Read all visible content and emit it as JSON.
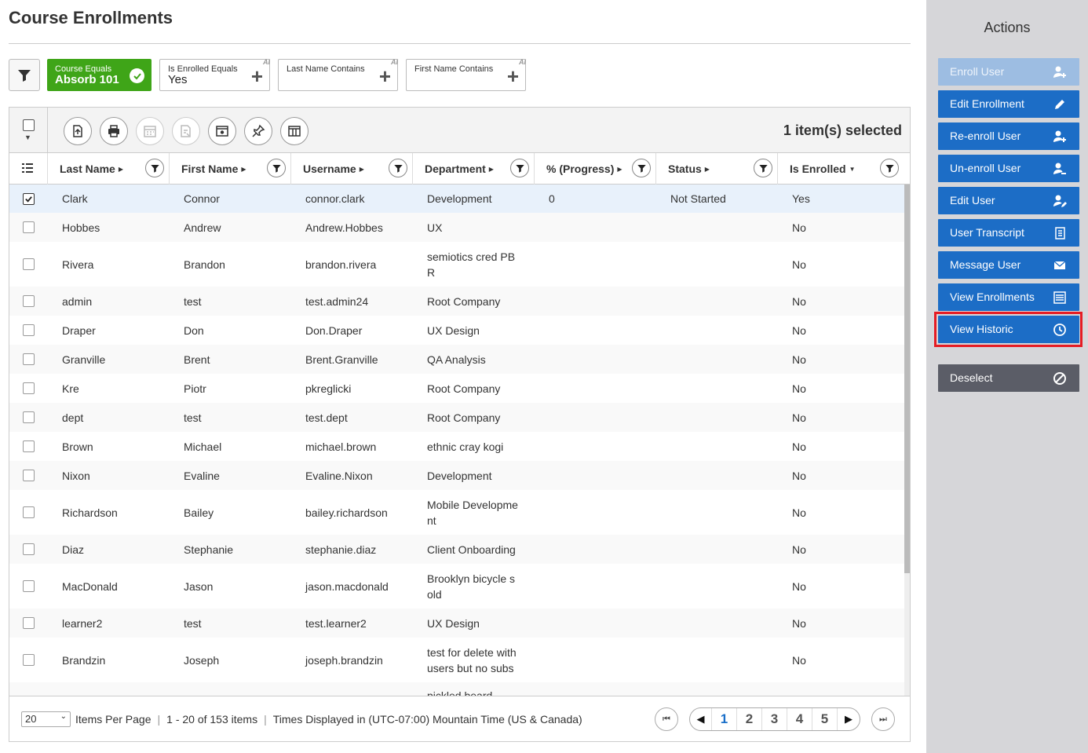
{
  "page": {
    "title": "Course Enrollments"
  },
  "filters": [
    {
      "label": "Course Equals",
      "value": "Absorb 101",
      "active": true
    },
    {
      "label": "Is Enrolled Equals",
      "value": "Yes",
      "active": false
    },
    {
      "label": "Last Name Contains",
      "value": "",
      "active": false
    },
    {
      "label": "First Name Contains",
      "value": "",
      "active": false
    }
  ],
  "toolbar": {
    "selected_count": "1 item(s) selected"
  },
  "columns": [
    "Last Name",
    "First Name",
    "Username",
    "Department",
    "% (Progress)",
    "Status",
    "Is Enrolled"
  ],
  "rows": [
    [
      "Clark",
      "Connor",
      "connor.clark",
      "Development",
      "0",
      "Not Started",
      "Yes"
    ],
    [
      "Hobbes",
      "Andrew",
      "Andrew.Hobbes",
      "UX",
      "",
      "",
      "No"
    ],
    [
      "Rivera",
      "Brandon",
      "brandon.rivera",
      "semiotics cred PB R",
      "",
      "",
      "No"
    ],
    [
      "admin",
      "test",
      "test.admin24",
      "Root Company",
      "",
      "",
      "No"
    ],
    [
      "Draper",
      "Don",
      "Don.Draper",
      "UX Design",
      "",
      "",
      "No"
    ],
    [
      "Granville",
      "Brent",
      "Brent.Granville",
      "QA Analysis",
      "",
      "",
      "No"
    ],
    [
      "Kre",
      "Piotr",
      "pkreglicki",
      "Root Company",
      "",
      "",
      "No"
    ],
    [
      "dept",
      "test",
      "test.dept",
      "Root Company",
      "",
      "",
      "No"
    ],
    [
      "Brown",
      "Michael",
      "michael.brown",
      "ethnic cray kogi",
      "",
      "",
      "No"
    ],
    [
      "Nixon",
      "Evaline",
      "Evaline.Nixon",
      "Development",
      "",
      "",
      "No"
    ],
    [
      "Richardson",
      "Bailey",
      "bailey.richardson",
      "Mobile Developme nt",
      "",
      "",
      "No"
    ],
    [
      "Diaz",
      "Stephanie",
      "stephanie.diaz",
      "Client Onboarding",
      "",
      "",
      "No"
    ],
    [
      "MacDonald",
      "Jason",
      "jason.macdonald",
      "Brooklyn bicycle s old",
      "",
      "",
      "No"
    ],
    [
      "learner2",
      "test",
      "test.learner2",
      "UX Design",
      "",
      "",
      "No"
    ],
    [
      "Brandzin",
      "Joseph",
      "joseph.brandzin",
      "test for delete with users but no subs",
      "",
      "",
      "No"
    ],
    [
      "",
      "",
      "",
      "pickled beard besp",
      "",
      "",
      ""
    ]
  ],
  "footer": {
    "per_page": "20",
    "per_page_label": "Items Per Page",
    "range": "1 - 20 of 153 items",
    "timezone": "Times Displayed in (UTC-07:00) Mountain Time (US & Canada)",
    "pages": [
      "1",
      "2",
      "3",
      "4",
      "5"
    ],
    "current_page": "1"
  },
  "actions": {
    "title": "Actions",
    "buttons": [
      {
        "label": "Enroll User",
        "icon": "user-plus-icon",
        "state": "disabled"
      },
      {
        "label": "Edit Enrollment",
        "icon": "pencil-icon",
        "state": "normal"
      },
      {
        "label": "Re-enroll User",
        "icon": "user-plus-icon",
        "state": "normal"
      },
      {
        "label": "Un-enroll User",
        "icon": "user-minus-icon",
        "state": "normal"
      },
      {
        "label": "Edit User",
        "icon": "user-edit-icon",
        "state": "normal"
      },
      {
        "label": "User Transcript",
        "icon": "transcript-icon",
        "state": "normal"
      },
      {
        "label": "Message User",
        "icon": "envelope-icon",
        "state": "normal"
      },
      {
        "label": "View Enrollments",
        "icon": "list-icon",
        "state": "normal"
      },
      {
        "label": "View Historic",
        "icon": "clock-icon",
        "state": "highlighted"
      },
      {
        "label": "Deselect",
        "icon": "ban-icon",
        "state": "dark"
      }
    ]
  },
  "colors": {
    "primary": "#1c6dc6",
    "active_filter": "#3fa518",
    "highlight": "#e51c24",
    "panel": "#d6d6d9"
  }
}
